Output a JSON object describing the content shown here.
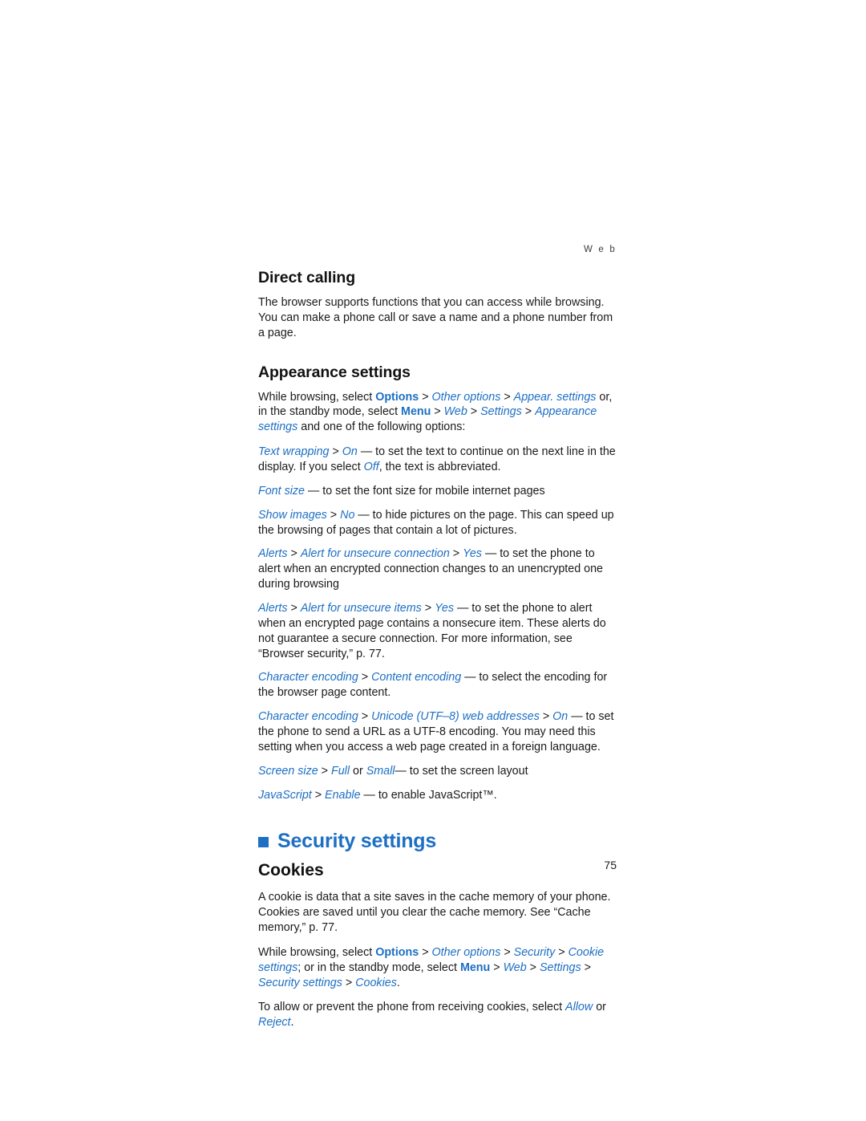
{
  "page": {
    "running_head": "W e b",
    "folio": "75"
  },
  "sections": {
    "direct_calling": {
      "heading": "Direct calling",
      "body": "The browser supports functions that you can access while browsing. You can make a phone call or save a name and a phone number from a page."
    },
    "appearance_settings": {
      "heading": "Appearance settings",
      "intro": {
        "p1": "While browsing, select ",
        "options": "Options",
        "sep1": " > ",
        "other_options": "Other options",
        "sep2": " > ",
        "appear_settings": "Appear. settings",
        "mid": " or, in the standby mode, select ",
        "menu": "Menu",
        "sep3": " > ",
        "web": "Web",
        "sep4": " > ",
        "settings": "Settings",
        "sep5": " > ",
        "appearance_settings": "Appearance settings",
        "tail": " and one of the following options:"
      },
      "items": [
        {
          "term": "Text wrapping",
          "sep": " > ",
          "value": "On",
          "dash": " — to set the text to continue on the next line in the display. If you select ",
          "value2": "Off",
          "tail": ", the text is abbreviated."
        },
        {
          "term": "Font size",
          "sep": "",
          "value": "",
          "dash": " — to set the font size for mobile internet pages",
          "value2": "",
          "tail": ""
        },
        {
          "term": "Show images",
          "sep": " > ",
          "value": "No",
          "dash": " — to hide pictures on the page. This can speed up the browsing of pages that contain a lot of pictures.",
          "value2": "",
          "tail": ""
        },
        {
          "term": "Alerts",
          "sep": " > ",
          "value": "Alert for unsecure connection",
          "sep2": " > ",
          "value2": "Yes",
          "dash": " — to set the phone to alert when an encrypted connection changes to an unencrypted one during browsing",
          "tail": ""
        },
        {
          "term": "Alerts",
          "sep": " > ",
          "value": "Alert for unsecure items",
          "sep2": " > ",
          "value2": "Yes",
          "dash": " — to set the phone to alert when an encrypted page contains a nonsecure item. These alerts do not guarantee a secure connection. For more information, see “Browser security,” p. 77.",
          "tail": ""
        },
        {
          "term": "Character encoding",
          "sep": " > ",
          "value": "Content encoding",
          "dash": " — to select the encoding for the browser page content.",
          "value2": "",
          "tail": ""
        },
        {
          "term": "Character encoding",
          "sep": " > ",
          "value": "Unicode (UTF–8) web addresses",
          "sep2": " > ",
          "value2": "On",
          "dash": " — to set the phone to send a URL as a UTF-8 encoding. You may need this setting when you access a web page created in a foreign language.",
          "tail": ""
        },
        {
          "term": "Screen size",
          "sep": " > ",
          "value": "Full",
          "mid": " or ",
          "value2": "Small",
          "dash": "— to set the screen layout",
          "tail": ""
        },
        {
          "term": "JavaScript",
          "sep": " > ",
          "value": "Enable",
          "dash": " — to enable JavaScript™.",
          "value2": "",
          "tail": ""
        }
      ]
    },
    "security_settings": {
      "heading": "Security settings",
      "cookies": {
        "heading": "Cookies",
        "p1": "A cookie is data that a site saves in the cache memory of your phone. Cookies are saved until you clear the cache memory. See “Cache memory,” p. 77.",
        "p2": {
          "lead": "While browsing, select ",
          "options": "Options",
          "sep1": " > ",
          "other_options": "Other options",
          "sep2": " > ",
          "security": "Security",
          "sep3": " > ",
          "cookie_settings": "Cookie settings",
          "mid": "; or in the standby mode, select ",
          "menu": "Menu",
          "sep4": " > ",
          "web": "Web",
          "sep5": " > ",
          "settings": "Settings",
          "sep6": " > ",
          "security_settings": "Security settings",
          "sep7": " > ",
          "cookies": "Cookies",
          "tail": "."
        },
        "p3": {
          "lead": "To allow or prevent the phone from receiving cookies, select ",
          "allow": "Allow",
          "mid": " or ",
          "reject": "Reject",
          "tail": "."
        }
      }
    }
  }
}
